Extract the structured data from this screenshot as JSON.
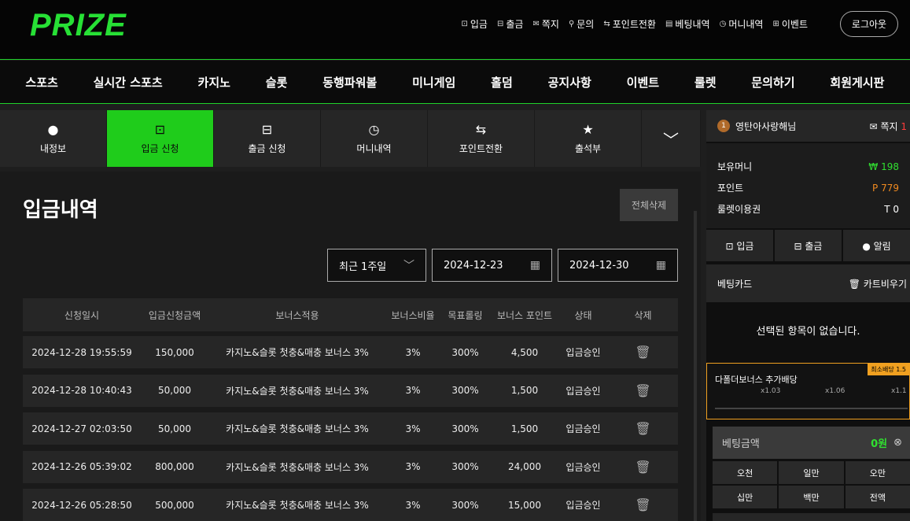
{
  "logo": "PRIZE",
  "toplinks": [
    {
      "icon": "wallet-icon",
      "glyph": "⊡",
      "label": "입금"
    },
    {
      "icon": "withdraw-icon",
      "glyph": "⊟",
      "label": "출금"
    },
    {
      "icon": "mail-icon",
      "glyph": "✉",
      "label": "쪽지"
    },
    {
      "icon": "inquiry-icon",
      "glyph": "⚲",
      "label": "문의"
    },
    {
      "icon": "exchange-icon",
      "glyph": "⇆",
      "label": "포인트전환"
    },
    {
      "icon": "betting-icon",
      "glyph": "▤",
      "label": "베팅내역"
    },
    {
      "icon": "clock-icon",
      "glyph": "◷",
      "label": "머니내역"
    },
    {
      "icon": "gift-icon",
      "glyph": "⊞",
      "label": "이벤트"
    }
  ],
  "logout": "로그아웃",
  "nav": [
    "스포츠",
    "실시간 스포츠",
    "카지노",
    "슬롯",
    "동행파워볼",
    "미니게임",
    "홀덤",
    "공지사항",
    "이벤트",
    "룰렛",
    "문의하기",
    "회원게시판"
  ],
  "tabs": [
    {
      "icon": "user-icon",
      "glyph": "●",
      "label": "내정보",
      "active": false
    },
    {
      "icon": "deposit-icon",
      "glyph": "⊡",
      "label": "입금 신청",
      "active": true
    },
    {
      "icon": "withdraw-icon",
      "glyph": "⊟",
      "label": "출금 신청",
      "active": false
    },
    {
      "icon": "clock-icon",
      "glyph": "◷",
      "label": "머니내역",
      "active": false
    },
    {
      "icon": "exchange-icon",
      "glyph": "⇆",
      "label": "포인트전환",
      "active": false
    },
    {
      "icon": "calendar-star-icon",
      "glyph": "★",
      "label": "출석부",
      "active": false
    }
  ],
  "page": {
    "title": "입금내역",
    "delete_all": "전체삭제",
    "period": "최근 1주일",
    "date_from": "2024-12-23",
    "date_to": "2024-12-30"
  },
  "table": {
    "headers": [
      "신청일시",
      "입금신청금액",
      "보너스적용",
      "보너스비율",
      "목표롤링",
      "보너스 포인트",
      "상태",
      "삭제"
    ],
    "rows": [
      [
        "2024-12-28 19:55:59",
        "150,000",
        "카지노&슬롯 첫충&매충 보너스 3%",
        "3%",
        "300%",
        "4,500",
        "입금승인"
      ],
      [
        "2024-12-28 10:40:43",
        "50,000",
        "카지노&슬롯 첫충&매충 보너스 3%",
        "3%",
        "300%",
        "1,500",
        "입금승인"
      ],
      [
        "2024-12-27 02:03:50",
        "50,000",
        "카지노&슬롯 첫충&매충 보너스 3%",
        "3%",
        "300%",
        "1,500",
        "입금승인"
      ],
      [
        "2024-12-26 05:39:02",
        "800,000",
        "카지노&슬롯 첫충&매충 보너스 3%",
        "3%",
        "300%",
        "24,000",
        "입금승인"
      ],
      [
        "2024-12-26 05:28:50",
        "500,000",
        "카지노&슬롯 첫충&매충 보너스 3%",
        "3%",
        "300%",
        "15,000",
        "입금승인"
      ]
    ]
  },
  "side": {
    "medal": "1",
    "username": "영탄아사랑해님",
    "msg_label": "쪽지",
    "msg_count": "1",
    "money_label": "보유머니",
    "money_value": "₩ 198",
    "point_label": "포인트",
    "point_value": "P 779",
    "roulette_label": "룰렛이용권",
    "roulette_value": "T 0",
    "btn_deposit": "⊡ 입금",
    "btn_withdraw": "⊟ 출금",
    "btn_alarm": "● 알림",
    "betcard_label": "베팅카드",
    "betcard_clear": "🗑 카트비우기",
    "empty": "선택된 항목이 없습니다.",
    "bonus_title": "다폴더보너스 추가배당",
    "bonus_badge": "최소배당 1.5",
    "multipliers": [
      "x1.03",
      "x1.06",
      "x1.1"
    ],
    "bet_label": "베팅금액",
    "bet_value": "0원",
    "amounts": [
      "오천",
      "일만",
      "오만",
      "십만",
      "백만",
      "전액"
    ]
  }
}
